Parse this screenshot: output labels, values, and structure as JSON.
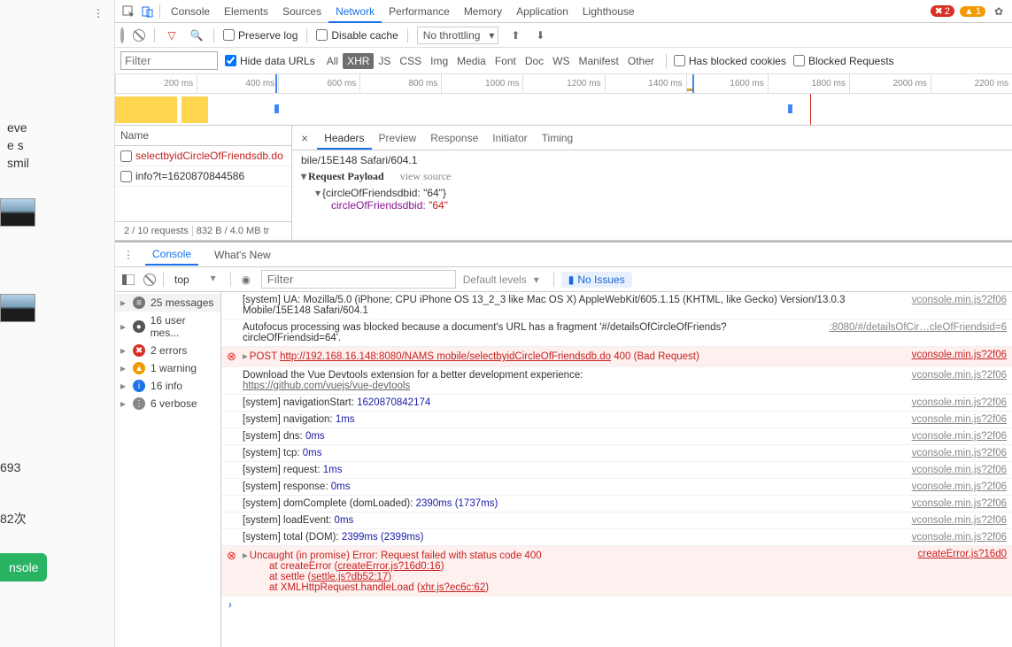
{
  "page_bg": {
    "snippets": [
      "eve",
      "e s",
      "smil"
    ],
    "metric1": "693",
    "metric2": "82次",
    "vconsole_btn": "nsole"
  },
  "devtools": {
    "tabs": [
      "Console",
      "Elements",
      "Sources",
      "Network",
      "Performance",
      "Memory",
      "Application",
      "Lighthouse"
    ],
    "active_tab": 3,
    "err_count": "2",
    "warn_count": "1"
  },
  "network": {
    "preserve": "Preserve log",
    "disable_cache": "Disable cache",
    "throttle": "No throttling",
    "filter_ph": "Filter",
    "hide_urls": "Hide data URLs",
    "types": [
      "All",
      "XHR",
      "JS",
      "CSS",
      "Img",
      "Media",
      "Font",
      "Doc",
      "WS",
      "Manifest",
      "Other"
    ],
    "active_type": 1,
    "blocked_cookies": "Has blocked cookies",
    "blocked_req": "Blocked Requests",
    "ruler": [
      "200 ms",
      "400 ms",
      "600 ms",
      "800 ms",
      "1000 ms",
      "1200 ms",
      "1400 ms",
      "1600 ms",
      "1800 ms",
      "2000 ms",
      "2200 ms"
    ],
    "list_head": "Name",
    "requests": [
      {
        "name": "selectbyidCircleOfFriendsdb.do",
        "err": true
      },
      {
        "name": "info?t=1620870844586",
        "err": false
      }
    ],
    "footer": {
      "count": "2 / 10 requests",
      "size": "832 B / 4.0 MB tr"
    },
    "detail_tabs": [
      "Headers",
      "Preview",
      "Response",
      "Initiator",
      "Timing"
    ],
    "active_detail": 0,
    "ua_frag": "bile/15E148 Safari/604.1",
    "payload_title": "Request Payload",
    "view_source": "view source",
    "payload_summary": "{circleOfFriendsdbid: \"64\"}",
    "payload_key": "circleOfFriendsdbid:",
    "payload_val": "\"64\""
  },
  "console": {
    "drawer_tabs": [
      "Console",
      "What's New"
    ],
    "ctx": "top",
    "filter_ph": "Filter",
    "levels": "Default levels",
    "no_issues": "No Issues",
    "side": [
      {
        "icon": "msg",
        "text": "25 messages",
        "tri": true,
        "sel": true
      },
      {
        "icon": "usr",
        "text": "16 user mes...",
        "tri": true
      },
      {
        "icon": "err",
        "text": "2 errors",
        "tri": true
      },
      {
        "icon": "wrn",
        "text": "1 warning",
        "tri": true
      },
      {
        "icon": "inf",
        "text": "16 info",
        "tri": true
      },
      {
        "icon": "vrb",
        "text": "6 verbose",
        "tri": true
      }
    ],
    "logs": [
      {
        "type": "log",
        "msg": "[system] UA: Mozilla/5.0 (iPhone; CPU iPhone OS 13_2_3 like Mac OS X) AppleWebKit/605.1.15 (KHTML, like Gecko) Version/13.0.3 Mobile/15E148 Safari/604.1",
        "src": "vconsole.min.js?2f06"
      },
      {
        "type": "log",
        "msg": "Autofocus processing was blocked because a document's URL has a fragment '#/detailsOfCircleOfFriends?circleOfFriendsid=64'.",
        "src": ":8080/#/detailsOfCir…cleOfFriendsid=6"
      },
      {
        "type": "err",
        "pre": "POST ",
        "url": "http://192.168.16.148:8080/NAMS mobile/selectbyidCircleOfFriendsdb.do",
        "post": " 400 (Bad Request)",
        "src": "vconsole.min.js?2f06",
        "tri": true
      },
      {
        "type": "log",
        "msg": "Download the Vue Devtools extension for a better development experience:\nhttps://github.com/vuejs/vue-devtools",
        "src": "vconsole.min.js?2f06",
        "link": true
      },
      {
        "type": "sys",
        "label": "navigationStart:",
        "val": "1620870842174",
        "src": "vconsole.min.js?2f06"
      },
      {
        "type": "sys",
        "label": "navigation:",
        "val": "1ms",
        "src": "vconsole.min.js?2f06"
      },
      {
        "type": "sys",
        "label": "dns:",
        "val": "0ms",
        "src": "vconsole.min.js?2f06"
      },
      {
        "type": "sys",
        "label": "tcp:",
        "val": "0ms",
        "src": "vconsole.min.js?2f06"
      },
      {
        "type": "sys",
        "label": "request:",
        "val": "1ms",
        "src": "vconsole.min.js?2f06"
      },
      {
        "type": "sys",
        "label": "response:",
        "val": "0ms",
        "src": "vconsole.min.js?2f06"
      },
      {
        "type": "sys",
        "label": "domComplete (domLoaded):",
        "val": "2390ms (1737ms)",
        "src": "vconsole.min.js?2f06"
      },
      {
        "type": "sys",
        "label": "loadEvent:",
        "val": "0ms",
        "src": "vconsole.min.js?2f06"
      },
      {
        "type": "sys",
        "label": "total (DOM):",
        "val": "2399ms (2399ms)",
        "src": "vconsole.min.js?2f06"
      },
      {
        "type": "trace",
        "head": "Uncaught (in promise) Error: Request failed with status code 400",
        "src": "createError.js?16d0",
        "stack": [
          {
            "fn": "at createError",
            "loc": "createError.js?16d0:16"
          },
          {
            "fn": "at settle",
            "loc": "settle.js?db52:17"
          },
          {
            "fn": "at XMLHttpRequest.handleLoad",
            "loc": "xhr.js?ec6c:62"
          }
        ]
      }
    ]
  }
}
